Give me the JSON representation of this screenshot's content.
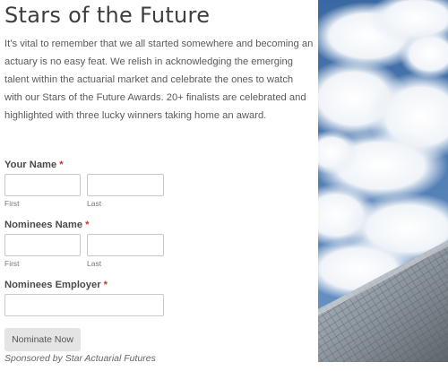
{
  "page": {
    "title": "Stars of the Future",
    "intro": "It’s vital to remember that we all started somewhere and becoming an actuary is no easy feat.  We relish in acknowledging the emerging talent within the actuarial market and celebrate the ones to watch with our Stars of the Future Awards.  20+ finalists are celebrated and highlighted with three lucky winners taking home an award."
  },
  "form": {
    "required_marker": "*",
    "your_name": {
      "label": "Your Name",
      "first_label": "First",
      "last_label": "Last",
      "first_value": "",
      "last_value": ""
    },
    "nominees_name": {
      "label": "Nominees Name",
      "first_label": "First",
      "last_label": "Last",
      "first_value": "",
      "last_value": ""
    },
    "nominees_employer": {
      "label": "Nominees Employer",
      "value": ""
    },
    "submit_label": "Nominate Now",
    "sponsor_text": "Sponsored by Star Actuarial Futures"
  },
  "colors": {
    "required": "#c0392b",
    "sky": "#3f6fa8",
    "button": "#e4e4e4"
  }
}
